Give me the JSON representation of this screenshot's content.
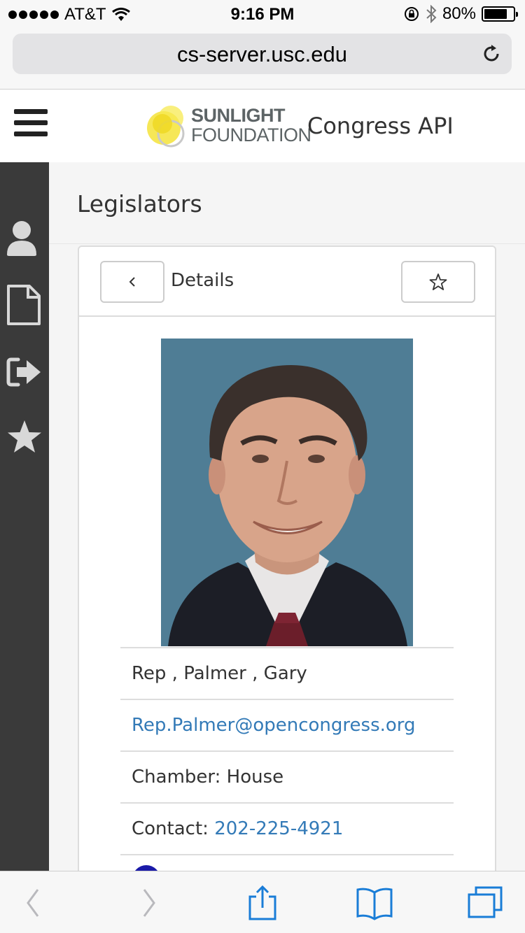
{
  "status_bar": {
    "carrier": "AT&T",
    "time": "9:16 PM",
    "battery_text": "80%",
    "battery_level": 0.8
  },
  "browser": {
    "url": "cs-server.usc.edu"
  },
  "app_header": {
    "logo_line1": "SUNLIGHT",
    "logo_line2": "FOUNDATION",
    "title": "Congress API"
  },
  "sidebar": {
    "items": [
      {
        "icon": "user-icon"
      },
      {
        "icon": "document-icon"
      },
      {
        "icon": "sign-out-icon"
      },
      {
        "icon": "star-icon"
      }
    ]
  },
  "main": {
    "page_title": "Legislators",
    "panel_title": "Details",
    "details": {
      "name": "Rep , Palmer , Gary",
      "email": "Rep.Palmer@opencongress.org",
      "chamber": "Chamber: House",
      "contact_label": "Contact: ",
      "contact_phone": "202-225-4921"
    }
  },
  "colors": {
    "sidebar": "#3a3a3a",
    "link": "#337ab7",
    "ios_blue": "#1a7dd7"
  }
}
